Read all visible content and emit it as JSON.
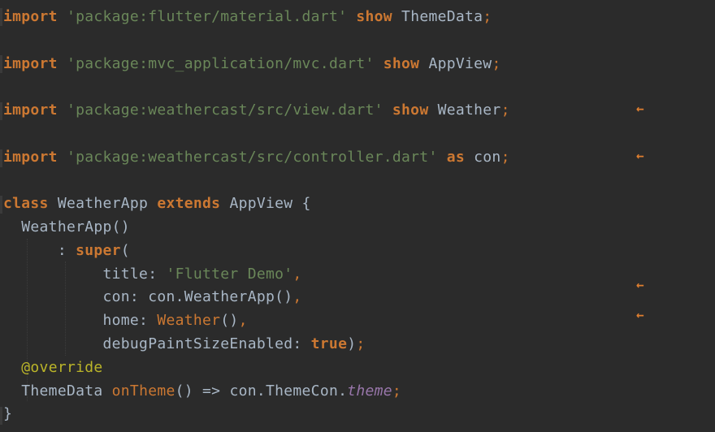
{
  "lines": [
    {
      "id": "l1",
      "parts": [
        {
          "c": "kw",
          "t": "import"
        },
        {
          "c": "plain",
          "t": " "
        },
        {
          "c": "str",
          "t": "'package:flutter/material.dart'"
        },
        {
          "c": "plain",
          "t": " "
        },
        {
          "c": "kw",
          "t": "show"
        },
        {
          "c": "plain",
          "t": " ThemeData"
        },
        {
          "c": "punc",
          "t": ";"
        }
      ]
    },
    {
      "id": "l2",
      "parts": [
        {
          "c": "kw",
          "t": "import"
        },
        {
          "c": "plain",
          "t": " "
        },
        {
          "c": "str",
          "t": "'package:mvc_application/mvc.dart'"
        },
        {
          "c": "plain",
          "t": " "
        },
        {
          "c": "kw",
          "t": "show"
        },
        {
          "c": "plain",
          "t": " AppView"
        },
        {
          "c": "punc",
          "t": ";"
        }
      ]
    },
    {
      "id": "l3",
      "parts": [
        {
          "c": "kw",
          "t": "import"
        },
        {
          "c": "plain",
          "t": " "
        },
        {
          "c": "str",
          "t": "'package:weathercast/src/view.dart'"
        },
        {
          "c": "plain",
          "t": " "
        },
        {
          "c": "kw",
          "t": "show"
        },
        {
          "c": "plain",
          "t": " Weather"
        },
        {
          "c": "punc",
          "t": ";"
        }
      ]
    },
    {
      "id": "l4",
      "parts": [
        {
          "c": "kw",
          "t": "import"
        },
        {
          "c": "plain",
          "t": " "
        },
        {
          "c": "str",
          "t": "'package:weathercast/src/controller.dart'"
        },
        {
          "c": "plain",
          "t": " "
        },
        {
          "c": "kw",
          "t": "as"
        },
        {
          "c": "plain",
          "t": " con"
        },
        {
          "c": "punc",
          "t": ";"
        }
      ]
    },
    {
      "id": "l5",
      "parts": [
        {
          "c": "kw",
          "t": "class"
        },
        {
          "c": "plain",
          "t": " WeatherApp "
        },
        {
          "c": "kw",
          "t": "extends"
        },
        {
          "c": "plain",
          "t": " AppView {"
        }
      ]
    },
    {
      "id": "l6",
      "parts": [
        {
          "c": "plain",
          "t": "  WeatherApp()"
        }
      ]
    },
    {
      "id": "l7",
      "parts": [
        {
          "c": "plain",
          "t": "      : "
        },
        {
          "c": "kw",
          "t": "super"
        },
        {
          "c": "plain",
          "t": "("
        }
      ]
    },
    {
      "id": "l8",
      "parts": [
        {
          "c": "plain",
          "t": "           title: "
        },
        {
          "c": "str",
          "t": "'Flutter Demo'"
        },
        {
          "c": "punc",
          "t": ","
        }
      ]
    },
    {
      "id": "l9",
      "parts": [
        {
          "c": "plain",
          "t": "           con: con.WeatherApp()"
        },
        {
          "c": "punc",
          "t": ","
        }
      ]
    },
    {
      "id": "l10",
      "parts": [
        {
          "c": "plain",
          "t": "           home: "
        },
        {
          "c": "fn",
          "t": "Weather"
        },
        {
          "c": "plain",
          "t": "()"
        },
        {
          "c": "punc",
          "t": ","
        }
      ]
    },
    {
      "id": "l11",
      "parts": [
        {
          "c": "plain",
          "t": "           debugPaintSizeEnabled: "
        },
        {
          "c": "kw",
          "t": "true"
        },
        {
          "c": "plain",
          "t": ")"
        },
        {
          "c": "punc",
          "t": ";"
        }
      ]
    },
    {
      "id": "l12",
      "parts": [
        {
          "c": "plain",
          "t": "  "
        },
        {
          "c": "ann",
          "t": "@override"
        }
      ]
    },
    {
      "id": "l13",
      "parts": [
        {
          "c": "plain",
          "t": "  ThemeData "
        },
        {
          "c": "fn",
          "t": "onTheme"
        },
        {
          "c": "plain",
          "t": "() => con.ThemeCon."
        },
        {
          "c": "it",
          "t": "theme"
        },
        {
          "c": "punc",
          "t": ";"
        }
      ]
    },
    {
      "id": "l14",
      "parts": [
        {
          "c": "plain",
          "t": "}"
        }
      ]
    }
  ],
  "marker_glyph": "←",
  "markers": [
    "l3",
    "l4",
    "l9",
    "l10"
  ],
  "colors": {
    "background": "#2b2b2b",
    "keyword": "#cc7832",
    "string": "#6a8759",
    "annotation": "#bbb529",
    "marker": "#e07f2f"
  }
}
